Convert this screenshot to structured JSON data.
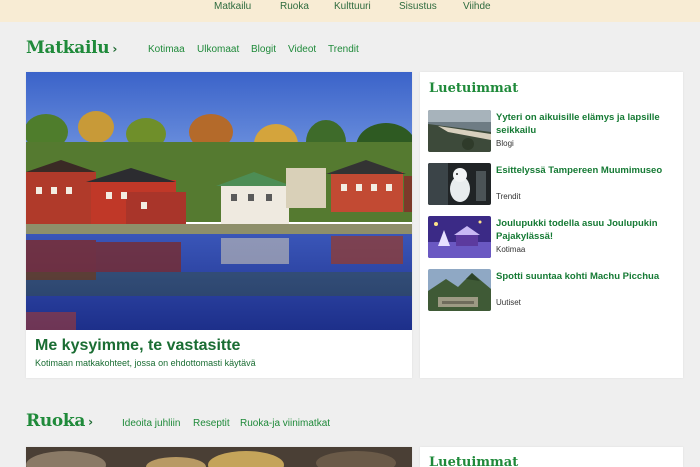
{
  "topnav": {
    "items": [
      "Matkailu",
      "Ruoka",
      "Kulttuuri",
      "Sisustus",
      "Viihde"
    ]
  },
  "travel": {
    "title": "Matkailu",
    "subnav": [
      "Kotimaa",
      "Ulkomaat",
      "Blogit",
      "Videot",
      "Trendit"
    ],
    "hero": {
      "title": "Me kysyimme, te vastasitte",
      "subtitle": "Kotimaan matkakohteet, jossa on ehdottomasti käytävä"
    },
    "sidebar": {
      "title": "Luetuimmat",
      "items": [
        {
          "headline": "Yyteri on aikuisille elämys ja lapsille seikkailu",
          "tag": "Blogi",
          "icon": "beach-thumb"
        },
        {
          "headline": "Esittelyssä Tampereen Muumimuseo",
          "tag": "Trendit",
          "icon": "moomin-thumb"
        },
        {
          "headline": "Joulupukki todella asuu Joulupukin Pajakylässä!",
          "tag": "Kotimaa",
          "icon": "santa-village-thumb"
        },
        {
          "headline": "Spotti suuntaa kohti Machu Picchua",
          "tag": "Uutiset",
          "icon": "machu-picchu-thumb"
        }
      ]
    }
  },
  "food": {
    "title": "Ruoka",
    "subnav": [
      "Ideoita juhliin",
      "Reseptit",
      "Ruoka-ja viinimatkat"
    ],
    "sidebar": {
      "title": "Luetuimmat"
    }
  },
  "colors": {
    "accent": "#1f8a3a",
    "topnav_bg": "#f8ecd4",
    "page_bg": "#efefef"
  }
}
